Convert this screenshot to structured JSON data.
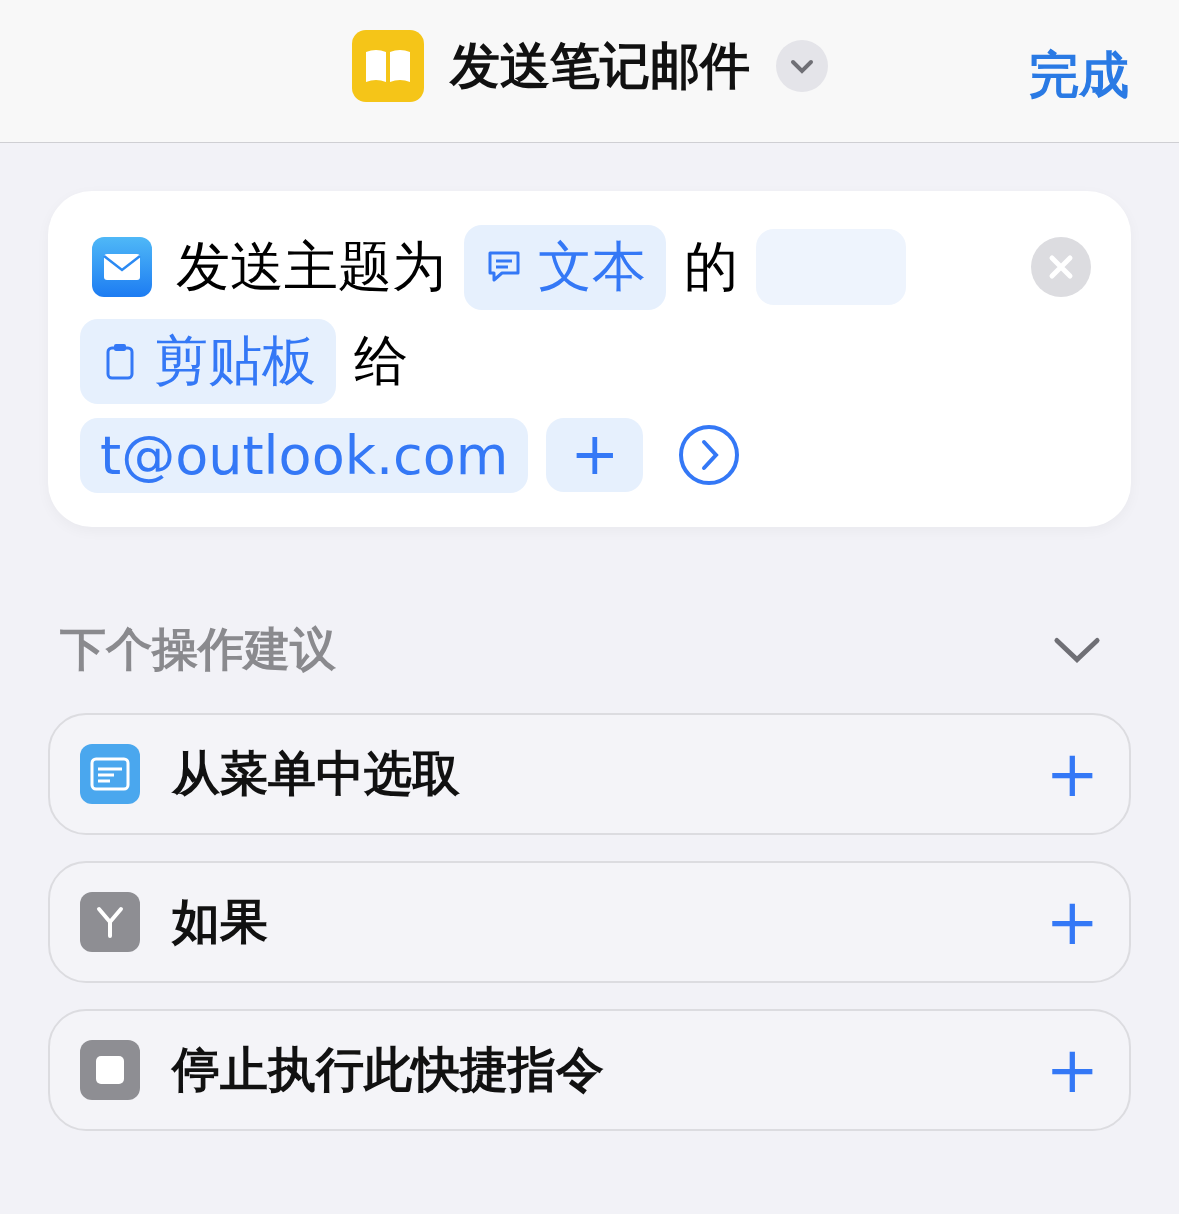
{
  "nav": {
    "title": "发送笔记邮件",
    "done": "完成"
  },
  "action": {
    "parts": [
      {
        "kind": "text",
        "text": "发送主题为"
      },
      {
        "kind": "message",
        "text": "文本"
      },
      {
        "kind": "text",
        "text": "的"
      },
      {
        "kind": "blank"
      },
      {
        "kind": "break"
      },
      {
        "kind": "clipboard",
        "text": "剪贴板"
      },
      {
        "kind": "text",
        "text": "给"
      },
      {
        "kind": "break"
      },
      {
        "kind": "token",
        "text": "t@outlook.com"
      },
      {
        "kind": "add",
        "text": "+"
      },
      {
        "kind": "more"
      }
    ]
  },
  "suggestions": {
    "title": "下个操作建议",
    "expanded": true,
    "items": [
      {
        "kind": "menu",
        "label": "从菜单中选取",
        "add": "+"
      },
      {
        "kind": "branch",
        "label": "如果",
        "add": "+"
      },
      {
        "kind": "stop",
        "label": "停止执行此快捷指令",
        "add": "+"
      }
    ]
  }
}
